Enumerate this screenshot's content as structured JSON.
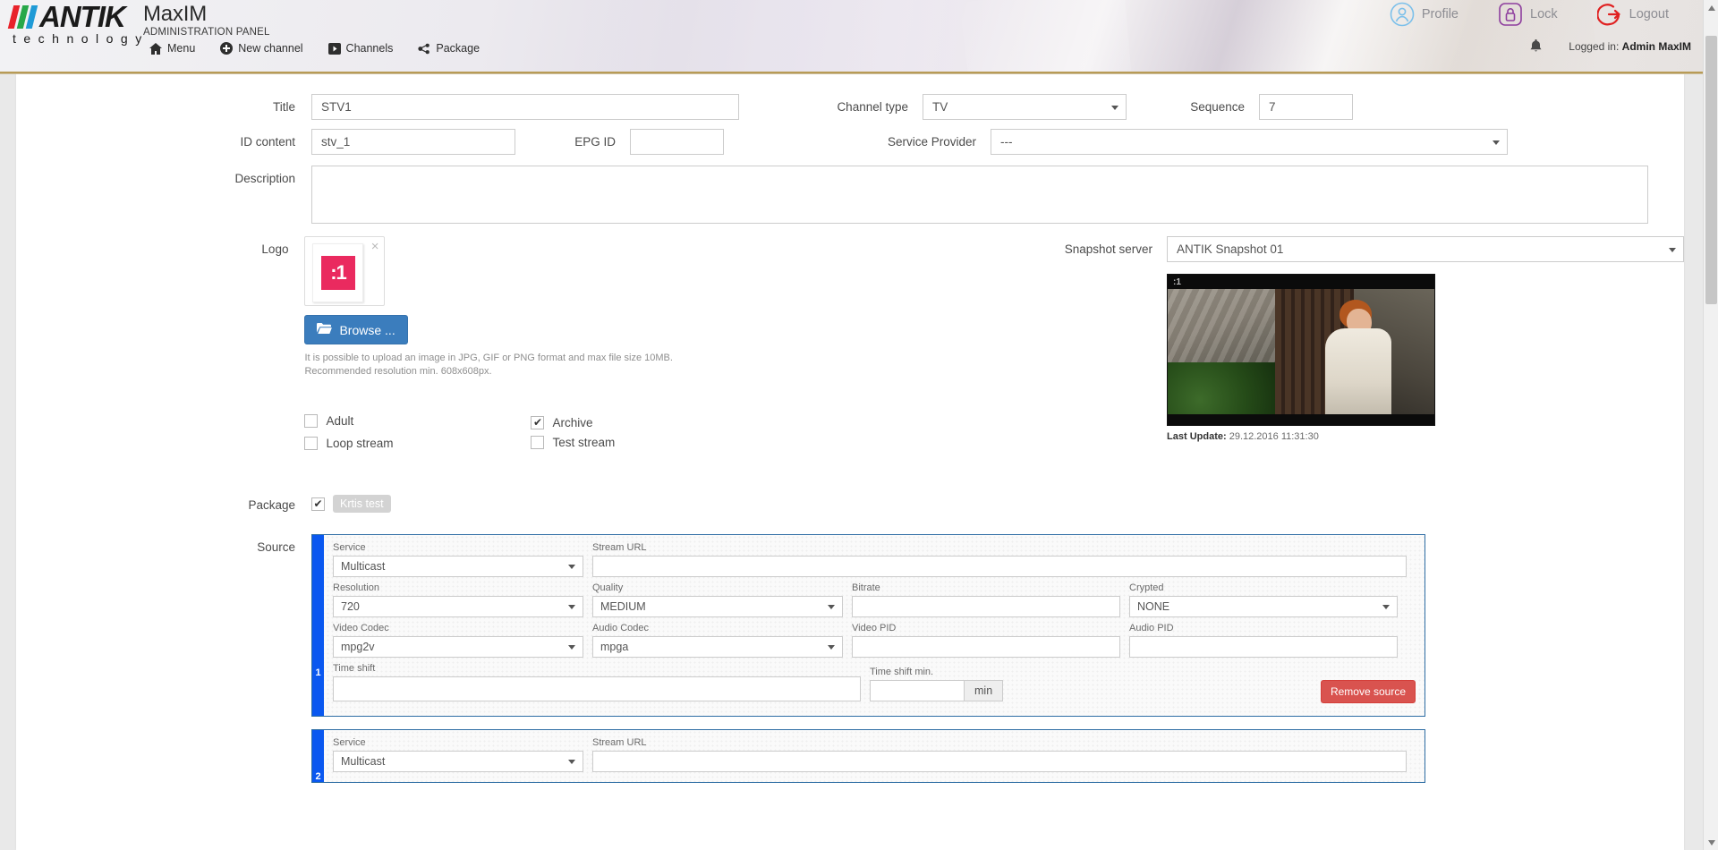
{
  "header": {
    "brand_word": "ANTIK",
    "brand_sub": "technology",
    "app_name": "MaxIM",
    "app_subtitle": "ADMINISTRATION PANEL",
    "nav": [
      {
        "label": "Menu",
        "icon": "home-icon"
      },
      {
        "label": "New channel",
        "icon": "plus-circle-icon"
      },
      {
        "label": "Channels",
        "icon": "play-box-icon"
      },
      {
        "label": "Package",
        "icon": "package-share-icon"
      }
    ],
    "actions": [
      {
        "label": "Profile",
        "icon": "user-circle-icon",
        "color": "#7cc0ea"
      },
      {
        "label": "Lock",
        "icon": "lock-icon",
        "color": "#8e3f9e"
      },
      {
        "label": "Logout",
        "icon": "logout-arrow-icon",
        "color": "#e02020"
      }
    ],
    "logged_in_prefix": "Logged in: ",
    "logged_in_user": "Admin MaxIM"
  },
  "form": {
    "title_label": "Title",
    "title_value": "STV1",
    "id_content_label": "ID content",
    "id_content_value": "stv_1",
    "epg_id_label": "EPG ID",
    "epg_id_value": "",
    "description_label": "Description",
    "description_value": "",
    "channel_type_label": "Channel type",
    "channel_type_value": "TV",
    "sequence_label": "Sequence",
    "sequence_value": "7",
    "service_provider_label": "Service Provider",
    "service_provider_value": "---",
    "logo_label": "Logo",
    "logo_mark_text": ":1",
    "logo_remove_icon": "close-icon",
    "browse_label": "Browse ...",
    "hint_line1": "It is possible to upload an image in JPG, GIF or PNG format and max file size 10MB.",
    "hint_line2": "Recommended resolution min. 608x608px.",
    "checkboxes": [
      {
        "label": "Adult",
        "checked": false
      },
      {
        "label": "Loop stream",
        "checked": false
      },
      {
        "label": "Archive",
        "checked": true
      },
      {
        "label": "Test stream",
        "checked": false
      }
    ],
    "snapshot_server_label": "Snapshot server",
    "snapshot_server_value": "ANTIK Snapshot 01",
    "snapshot_overlay_text": ":1",
    "last_update_label": "Last Update:",
    "last_update_value": "29.12.2016 11:31:30",
    "package_label": "Package",
    "package_checked": true,
    "package_badge": "Krtis test",
    "source_label": "Source"
  },
  "sources": [
    {
      "index": "1",
      "service_label": "Service",
      "service_value": "Multicast",
      "stream_url_label": "Stream URL",
      "stream_url_value": "",
      "resolution_label": "Resolution",
      "resolution_value": "720",
      "quality_label": "Quality",
      "quality_value": "MEDIUM",
      "bitrate_label": "Bitrate",
      "bitrate_value": "",
      "crypted_label": "Crypted",
      "crypted_value": "NONE",
      "video_codec_label": "Video Codec",
      "video_codec_value": "mpg2v",
      "audio_codec_label": "Audio Codec",
      "audio_codec_value": "mpga",
      "video_pid_label": "Video PID",
      "video_pid_value": "",
      "audio_pid_label": "Audio PID",
      "audio_pid_value": "",
      "time_shift_label": "Time shift",
      "time_shift_value": "",
      "time_shift_min_label": "Time shift min.",
      "time_shift_min_value": "",
      "time_shift_min_addon": "min",
      "remove_label": "Remove source"
    },
    {
      "index": "2",
      "service_label": "Service",
      "service_value": "Multicast",
      "stream_url_label": "Stream URL",
      "stream_url_value": ""
    }
  ],
  "colors": {
    "accent_blue": "#0a58f0",
    "browse_blue": "#3b7dbd",
    "danger_red": "#d9534f",
    "logo_pink": "#ea2a5f",
    "header_rule": "#b89b56"
  }
}
